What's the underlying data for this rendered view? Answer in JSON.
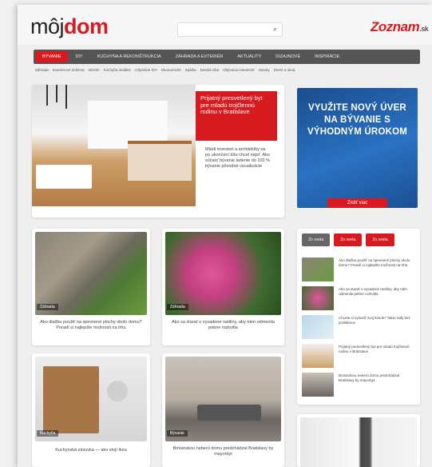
{
  "header": {
    "logo_moj": "môj",
    "logo_dom": "dom",
    "search_icon": "search-icon",
    "partner_logo": "Zoznam",
    "partner_logo_suffix": ".sk"
  },
  "nav": {
    "items": [
      "Bývanie",
      "DIY",
      "Kuchyňa a Rekonštrukcia",
      "Záhrada a Exteriér",
      "Aktuality",
      "Dizajnové",
      "Inspirácie"
    ]
  },
  "subnav": {
    "items": [
      "Záhrada",
      "Exteriérové riešenia",
      "Interiér",
      "Kuchyňa Jedálen",
      "Inšpirácie DIY",
      "Ekonomické",
      "Spálňa",
      "Detská izba",
      "Obývacia miestnosť",
      "Stavby",
      "Dvere a okná"
    ]
  },
  "hero": {
    "title": "Prijatný presvetlený byt pre mladú trojčlennú rodinu v Bratislave",
    "text": "Mladí investori a architektky sa po ukončení túto chcel nájsť. Ako súčasť bývanie ladenie do 100 % bývanie pôvodné vizualizácie"
  },
  "ad": {
    "text": "Využite nový úver na bývanie s výhodným úrokom",
    "button": "Zistiť viac"
  },
  "cards": [
    {
      "label": "Záhrada",
      "caption": "Ako dlažbu použiť na spevnené plochy okolo domu? Poradí si najlepšie možnosti na trhu"
    },
    {
      "label": "Záhrada",
      "caption": "Ako sa starať o vysadené rastliny, aby nám odmenila pekne rozkvitla"
    },
    {
      "label": "Kuchyňa",
      "caption": "Kuchynská zásuvka — ako stojí Ikea"
    },
    {
      "label": "Bývanie",
      "caption": "Brnianskou neberú domu predchádzal Bratislavy by mayorbyt"
    }
  ],
  "sidebar": {
    "tabs": [
      "Zo sveta",
      "Zo sveta",
      "Zo sveta"
    ],
    "items": [
      "Ako dlažbu použiť na spevnené plochy okolo domu? Poradí si najlepšie možnosti na trhu",
      "Ako sa starať o vysadené rastliny, aby nám odmenila pekne rozkvitla",
      "Chcete si vytvoriť svoj kúsok? Takto rady bez problémov",
      "Prijatný presvetlený byt pre mladú trojčlennú rodinu v Bratislave",
      "Brnianskou neberú domu predchádzal Bratislavy by mayorbyt"
    ]
  },
  "colors": {
    "brand_red": "#d71920",
    "nav_gray": "#555555",
    "ad_blue": "#2a72c2"
  }
}
